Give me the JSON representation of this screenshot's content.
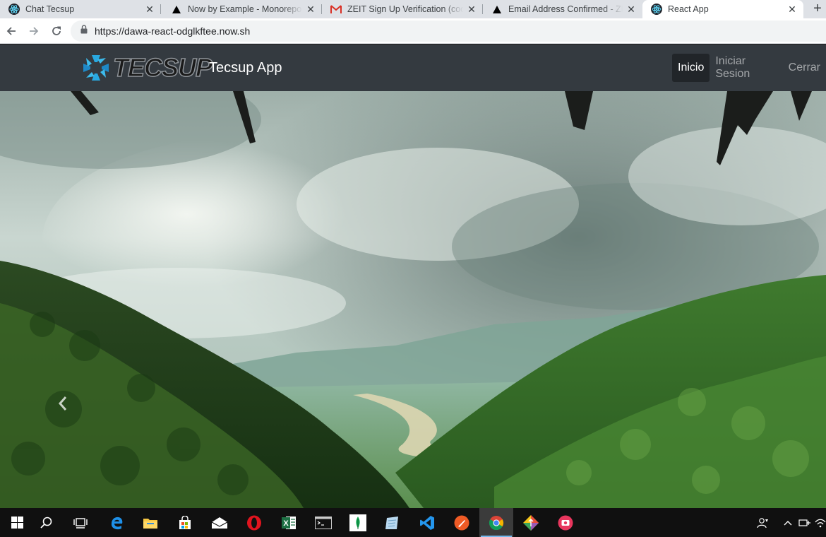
{
  "browser": {
    "tabs": [
      {
        "title": "Chat Tecsup",
        "icon": "react-icon",
        "active": false
      },
      {
        "title": "Now by Example - Monorepo",
        "icon": "zeit-triangle-icon",
        "active": false
      },
      {
        "title": "ZEIT Sign Up Verification (code",
        "icon": "gmail-icon",
        "active": false
      },
      {
        "title": "Email Address Confirmed - ZEIT",
        "icon": "zeit-triangle-icon",
        "active": false
      },
      {
        "title": "React App",
        "icon": "react-icon",
        "active": true
      }
    ],
    "url": "https://dawa-react-odglkftee.now.sh"
  },
  "app": {
    "logo_text": "TECSUP",
    "brand": "Tecsup App",
    "nav": [
      {
        "label": "Inicio",
        "active": true
      },
      {
        "label": "Iniciar Sesion",
        "active": false
      },
      {
        "label": "Cerrar",
        "active": false
      }
    ]
  },
  "hero": {
    "image": "mountain-valley-river-landscape",
    "control": "chevron-left-icon"
  },
  "taskbar": {
    "apps": [
      "start-icon",
      "search-icon",
      "task-view-icon",
      "edge-icon",
      "file-explorer-icon",
      "store-icon",
      "mail-icon",
      "opera-icon",
      "excel-icon",
      "terminal-icon",
      "mongodb-compass-icon",
      "notepad-icon",
      "vscode-icon",
      "postman-icon",
      "chrome-icon",
      "gitkraken-icon",
      "screen-recorder-icon"
    ],
    "tray": [
      "people-icon",
      "chevron-up-icon",
      "network-icon",
      "wifi-icon"
    ]
  },
  "colors": {
    "navbar_bg": "#343a40",
    "navbar_active": "#212529",
    "tab_strip": "#dee1e6",
    "taskbar": "#101010"
  }
}
